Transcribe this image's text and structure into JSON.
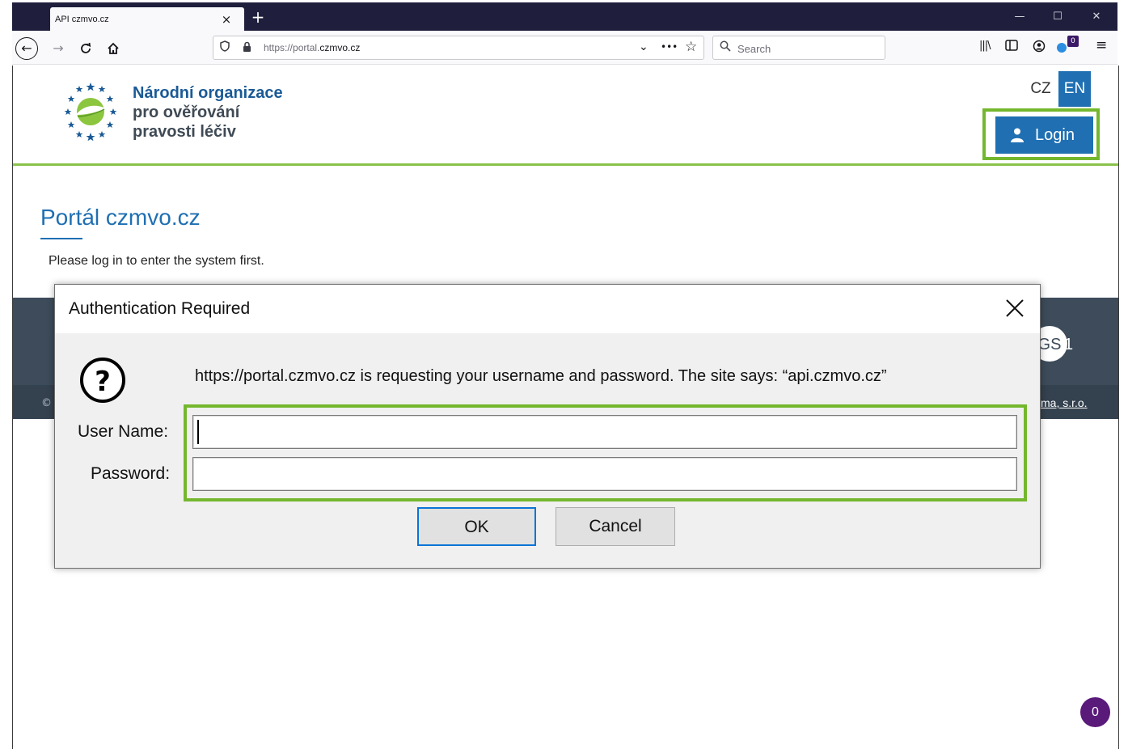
{
  "browser": {
    "tab_title": "API czmvo.cz",
    "tab_close": "×",
    "new_tab": "+",
    "window_controls": {
      "minimize": "—",
      "maximize": "☐",
      "close": "✕"
    },
    "url_prefix": "https://portal.",
    "url_domain": "czmvo.cz",
    "url_more": "•••",
    "search_placeholder": "Search",
    "notification_count": "0"
  },
  "header": {
    "brand_line1": "Národní organizace",
    "brand_line2": "pro ověřování",
    "brand_line3": "pravosti léčiv",
    "lang_cz": "CZ",
    "lang_en": "EN",
    "login_label": "Login"
  },
  "main": {
    "page_title": "Portál czmvo.cz",
    "intro_text": "Please log in to enter the system first."
  },
  "footer": {
    "copyright_fragment": "©",
    "link_fragment": "ma, s.r.o.",
    "gs1_logo_text": "GS1"
  },
  "dialog": {
    "title": "Authentication Required",
    "message": "https://portal.czmvo.cz is requesting your username and password. The site says: “api.czmvo.cz”",
    "username_label": "User Name:",
    "password_label": "Password:",
    "username_value": "",
    "password_value": "",
    "ok_label": "OK",
    "cancel_label": "Cancel"
  },
  "chat": {
    "count": "0"
  },
  "colors": {
    "accent_blue": "#1f6fb2",
    "highlight_green": "#74b72e",
    "footer_dark": "#3d4b5a",
    "chat_purple": "#5a1a7a"
  }
}
